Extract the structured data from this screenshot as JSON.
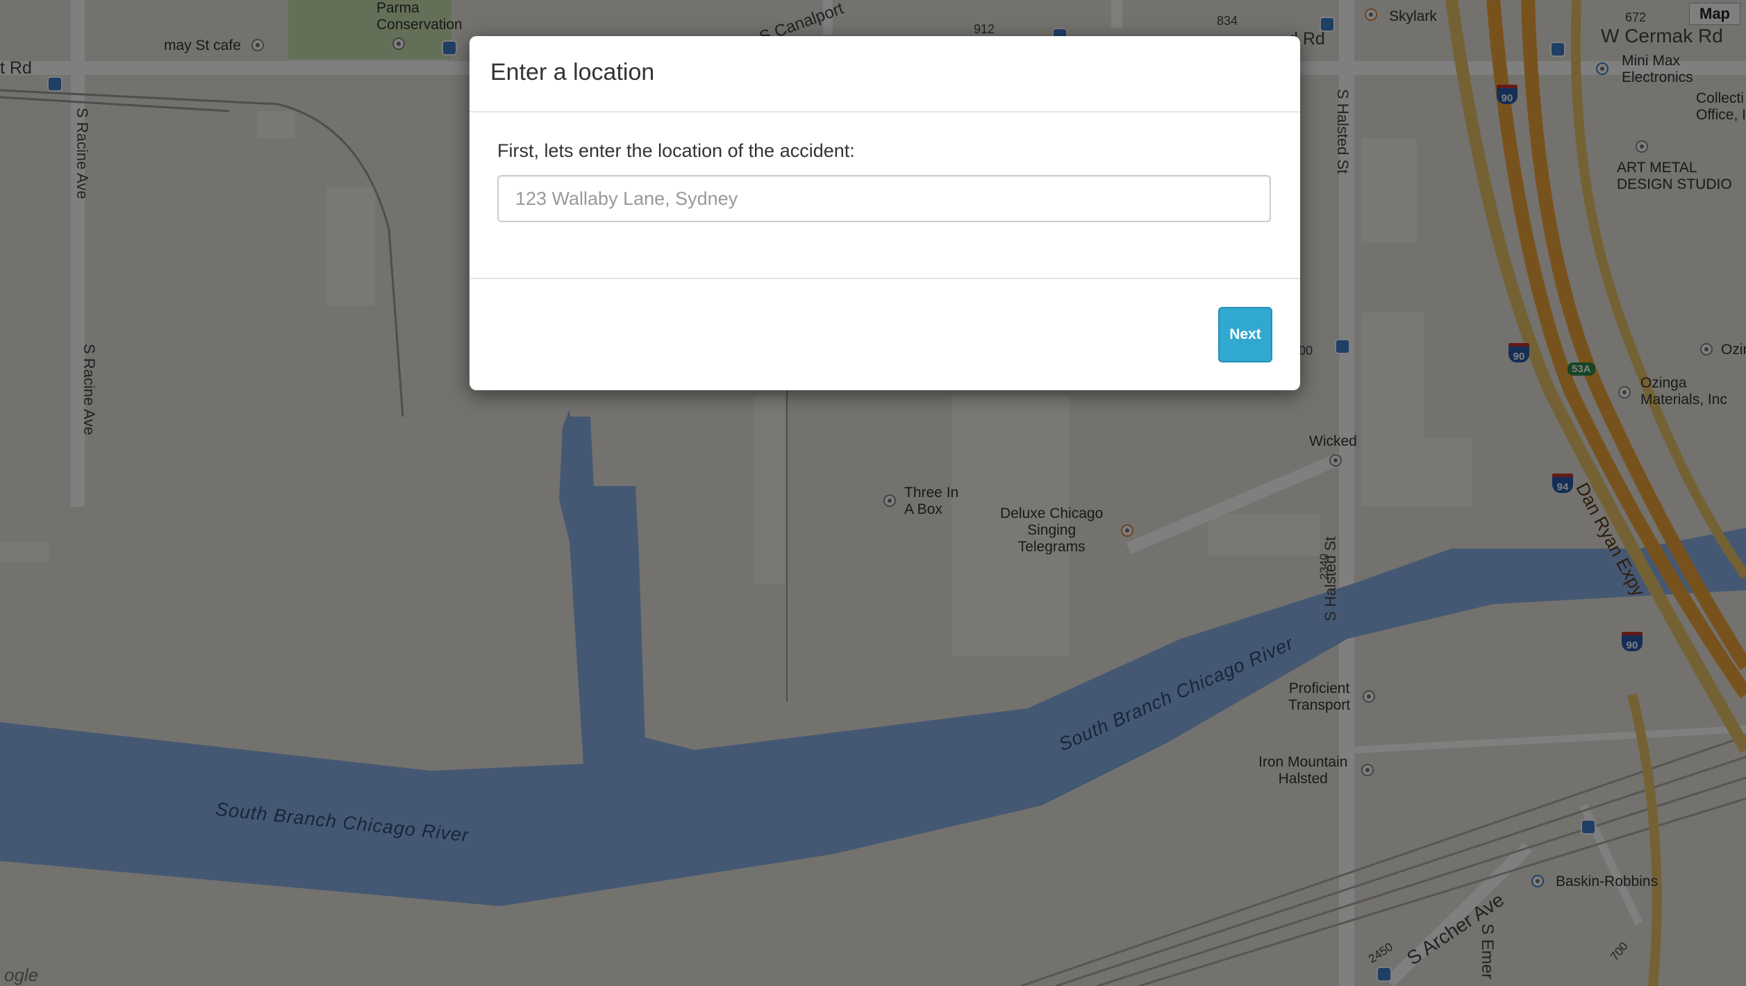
{
  "map": {
    "map_type_button": "Map",
    "attribution": "ogle",
    "streets": {
      "cermak": "W Cermak Rd",
      "racine_top": "S Racine Ave",
      "racine_bottom": "S Racine Ave",
      "halsted_top": "S Halsted St",
      "halsted_bottom": "S Halsted St",
      "canalport": "S Canalport",
      "archer": "S Archer Ave",
      "emerald": "S Emer",
      "dan_ryan": "Dan Ryan Expy",
      "left_rd": "t Rd",
      "top_rd": "d Rd"
    },
    "numbers": {
      "n912": "912",
      "n834": "834",
      "n672": "672",
      "n2340": "2340",
      "n2450": "2450",
      "n700": "700",
      "n00": "00"
    },
    "river_labels": {
      "left": "South Branch Chicago River",
      "right": "South Branch Chicago River"
    },
    "places": {
      "parma": "Parma\nConservation",
      "may_st_cafe": "may St cafe",
      "skylark": "Skylark",
      "mini_max": "Mini Max\nElectronics",
      "collection_office": "Collecti\nOffice, I",
      "art_metal": "ART METAL\nDESIGN STUDIO",
      "ozinga_partial": "Ozin",
      "ozinga": "Ozinga\nMaterials, Inc",
      "wicked": "Wicked",
      "three_in_a_box": "Three In\nA Box",
      "deluxe": "Deluxe Chicago\nSinging\nTelegrams",
      "proficient": "Proficient\nTransport",
      "iron_mountain": "Iron Mountain\nHalsted",
      "baskin": "Baskin-Robbins"
    },
    "shields": {
      "i90_top": "90",
      "i90_mid": "90",
      "i94": "94",
      "i90_low": "90",
      "exit_53a": "53A"
    }
  },
  "modal": {
    "title": "Enter a location",
    "prompt": "First, lets enter the location of the accident:",
    "input_value": "",
    "input_placeholder": "123 Wallaby Lane, Sydney",
    "next_label": "Next"
  }
}
